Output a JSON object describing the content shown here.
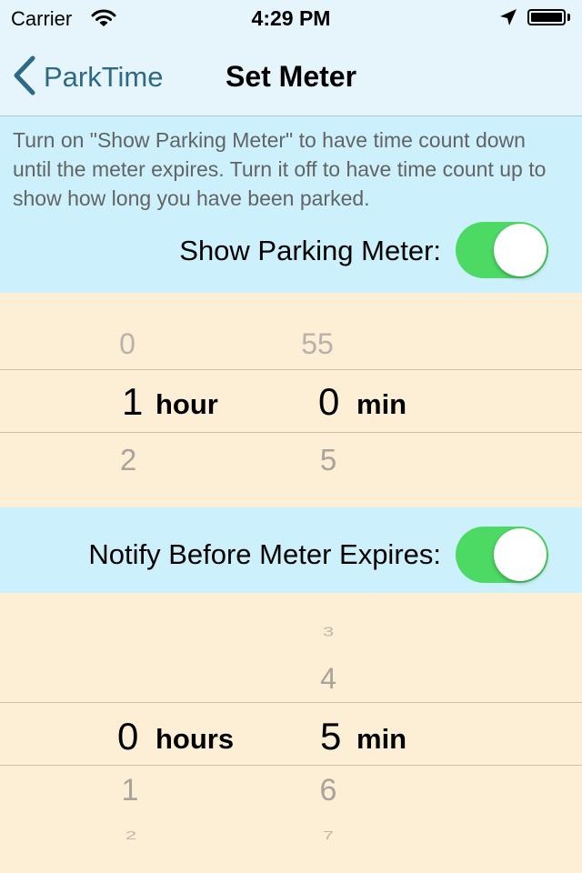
{
  "status_bar": {
    "carrier": "Carrier",
    "time": "4:29 PM"
  },
  "nav": {
    "back_label": "ParkTime",
    "title": "Set Meter"
  },
  "meter_section": {
    "description": "Turn on \"Show Parking Meter\" to have time count down until the meter expires. Turn it off to have time count up to show how long you have been parked.",
    "toggle_label": "Show Parking Meter:",
    "toggle_on": true
  },
  "meter_picker": {
    "hours_above": "0",
    "hours_selected": "1",
    "hours_unit": "hour",
    "hours_below": "2",
    "minutes_above": "55",
    "minutes_selected": "0",
    "minutes_unit": "min",
    "minutes_below": "5"
  },
  "notify_section": {
    "toggle_label": "Notify Before Meter Expires:",
    "toggle_on": true
  },
  "notify_picker": {
    "hours_selected": "0",
    "hours_unit": "hours",
    "hours_below": "1",
    "hours_below_2": "2",
    "minutes_above_2": "3",
    "minutes_above": "4",
    "minutes_selected": "5",
    "minutes_unit": "min",
    "minutes_below": "6",
    "minutes_below_2": "7"
  },
  "colors": {
    "accent_green": "#4cd964",
    "nav_tint": "#2d6a86",
    "panel_blue": "#cdf1fc",
    "picker_cream": "#fdefd6"
  },
  "icons": [
    "wifi-icon",
    "location-arrow-icon",
    "battery-icon",
    "chevron-left-icon"
  ]
}
